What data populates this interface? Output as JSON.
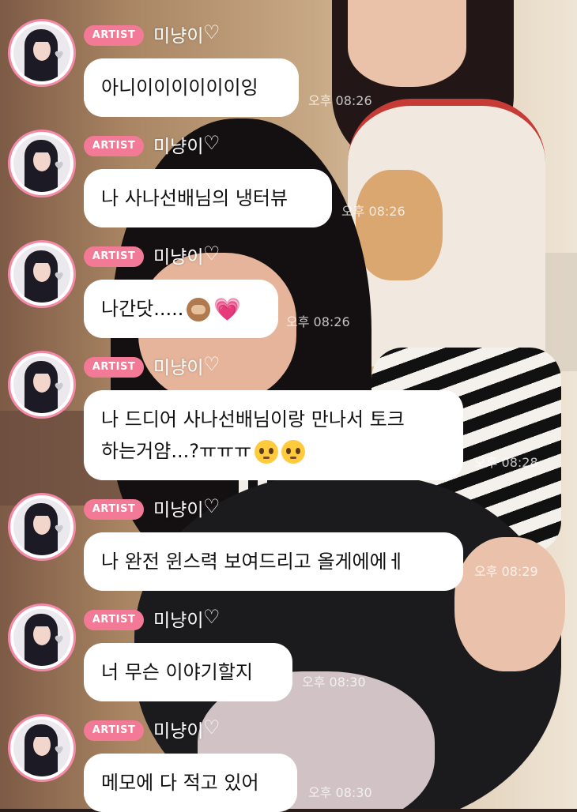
{
  "colors": {
    "badge": "#f37a96",
    "avatar_ring": "#f48aa8",
    "bubble": "#ffffff"
  },
  "messages": [
    {
      "badge": "ARTIST",
      "sender": "미냥이",
      "sender_icon": "white-heart-icon",
      "lines": [
        "아니이이이이이이잉"
      ],
      "emojis": [],
      "time": "오후 08:26"
    },
    {
      "badge": "ARTIST",
      "sender": "미냥이",
      "sender_icon": "white-heart-icon",
      "lines": [
        "나 사나선배님의 냉터뷰"
      ],
      "emojis": [],
      "time": "오후 08:26"
    },
    {
      "badge": "ARTIST",
      "sender": "미냥이",
      "sender_icon": "white-heart-icon",
      "lines": [
        "나간닷....."
      ],
      "emojis": [
        "see-no-evil-monkey-icon",
        "sparkling-heart-icon"
      ],
      "time": "오후 08:26"
    },
    {
      "badge": "ARTIST",
      "sender": "미냥이",
      "sender_icon": "white-heart-icon",
      "lines": [
        "나 드디어 사나선배님이랑 만나서 토크",
        "하는거얌...?ㅠㅠㅠ"
      ],
      "emojis": [
        "pleading-face-icon",
        "pleading-face-icon"
      ],
      "time": "오후 08:28"
    },
    {
      "badge": "ARTIST",
      "sender": "미냥이",
      "sender_icon": "white-heart-icon",
      "lines": [
        "나 완전 윈스력 보여드리고 올게에에ㅔ"
      ],
      "emojis": [],
      "time": "오후 08:29"
    },
    {
      "badge": "ARTIST",
      "sender": "미냥이",
      "sender_icon": "white-heart-icon",
      "lines": [
        "너 무슨 이야기할지"
      ],
      "emojis": [],
      "time": "오후 08:30"
    },
    {
      "badge": "ARTIST",
      "sender": "미냥이",
      "sender_icon": "white-heart-icon",
      "lines": [
        "메모에 다 적고 있어"
      ],
      "emojis": [],
      "time": "오후 08:30"
    }
  ]
}
